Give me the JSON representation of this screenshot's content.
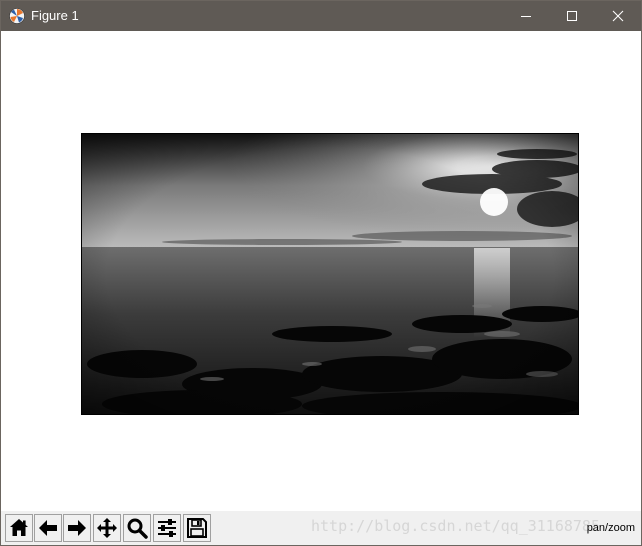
{
  "window": {
    "title": "Figure 1",
    "app_icon": "matplotlib-icon",
    "controls": [
      "minimize-icon",
      "maximize-icon",
      "close-icon"
    ]
  },
  "figure": {
    "image_description_colors": {
      "sky_top": "#1a1a1a",
      "sun_glow": "#ffffff",
      "sea": "#3a3a3a",
      "rocks": "#0c0c0c"
    }
  },
  "toolbar": {
    "buttons": [
      {
        "icon": "home-icon"
      },
      {
        "icon": "back-arrow-icon"
      },
      {
        "icon": "forward-arrow-icon"
      },
      {
        "icon": "pan-icon"
      },
      {
        "icon": "zoom-icon"
      },
      {
        "icon": "subplots-icon"
      },
      {
        "icon": "save-icon"
      }
    ],
    "status": "pan/zoom",
    "watermark": "http://blog.csdn.net/qq_31168785"
  }
}
